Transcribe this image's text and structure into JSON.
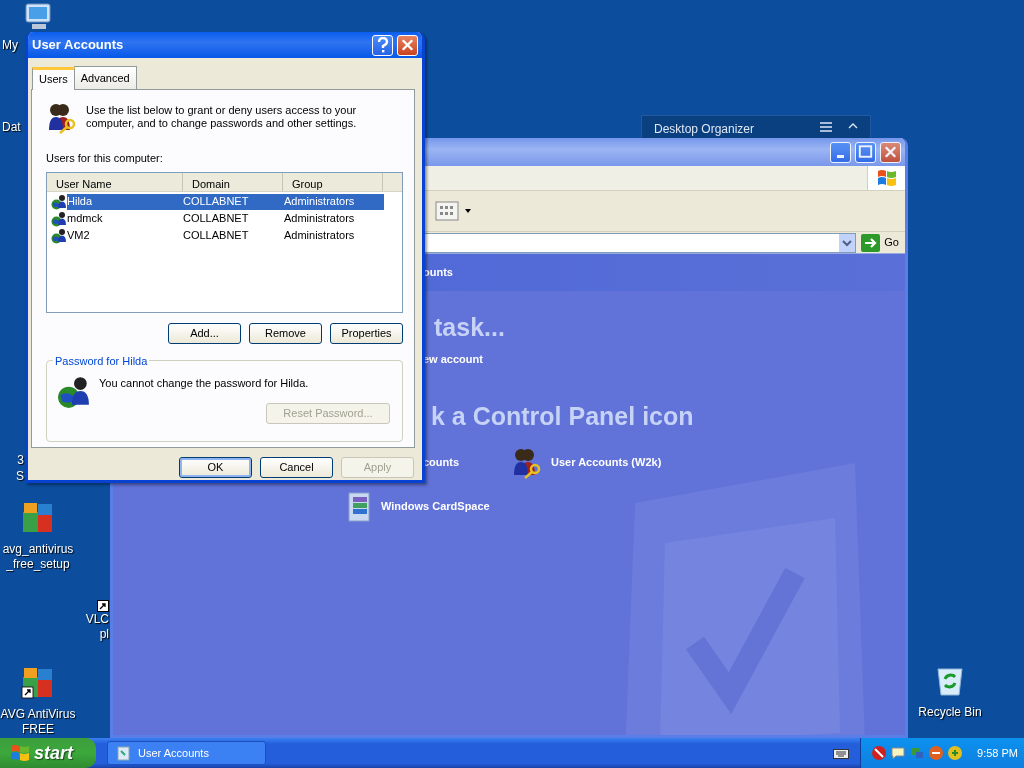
{
  "desktop_icons": [
    {
      "kind": "computer",
      "lines": [
        "My"
      ]
    },
    {
      "kind": "none",
      "lines": [
        "Dat"
      ]
    },
    {
      "kind": "none",
      "lines": [
        "3",
        "S"
      ]
    },
    {
      "kind": "avg",
      "lines": [
        "avg_antivirus",
        "_free_setup"
      ]
    },
    {
      "kind": "shortcut",
      "lines": [
        "VLC",
        "pl"
      ]
    },
    {
      "kind": "avg-shortcut",
      "lines": [
        "AVG AntiVirus",
        "FREE"
      ]
    },
    {
      "kind": "recycle",
      "lines": [
        "Recycle Bin"
      ]
    }
  ],
  "desktop_organizer": {
    "title": "Desktop Organizer"
  },
  "explorer_window": {
    "go": "Go",
    "header": "ounts",
    "task_heading": "task...",
    "tasks": [
      "ew account"
    ],
    "icons_heading": "k a Control Panel icon",
    "icons": [
      {
        "kind": "none",
        "label": "counts"
      },
      {
        "kind": "users",
        "label": "User Accounts (W2k)"
      },
      {
        "kind": "cardspace",
        "label": "Windows CardSpace"
      }
    ]
  },
  "dialog": {
    "title": "User Accounts",
    "tabs": [
      {
        "label": "Users",
        "selected": true
      },
      {
        "label": "Advanced",
        "selected": false
      }
    ],
    "intro": "Use the list below to grant or deny users access to your computer, and to change passwords and other settings.",
    "list_label": "Users for this computer:",
    "columns": [
      "User Name",
      "Domain",
      "Group"
    ],
    "rows": [
      {
        "user_name": "Hilda",
        "domain": "COLLABNET",
        "group": "Administrators",
        "selected": true
      },
      {
        "user_name": "mdmck",
        "domain": "COLLABNET",
        "group": "Administrators",
        "selected": false
      },
      {
        "user_name": "VM2",
        "domain": "COLLABNET",
        "group": "Administrators",
        "selected": false
      }
    ],
    "list_buttons": [
      {
        "label": "Add...",
        "disabled": false
      },
      {
        "label": "Remove",
        "disabled": false
      },
      {
        "label": "Properties",
        "disabled": false
      }
    ],
    "password_group": {
      "title": "Password for Hilda",
      "message": "You cannot change the password for Hilda.",
      "button": {
        "label": "Reset Password...",
        "disabled": true
      }
    },
    "buttons": [
      {
        "label": "OK",
        "default": true,
        "disabled": false
      },
      {
        "label": "Cancel",
        "default": false,
        "disabled": false
      },
      {
        "label": "Apply",
        "default": false,
        "disabled": true
      }
    ]
  },
  "taskbar": {
    "start": "start",
    "tasks": [
      {
        "label": "User Accounts",
        "selected": false
      }
    ],
    "clock": "9:58 PM"
  }
}
